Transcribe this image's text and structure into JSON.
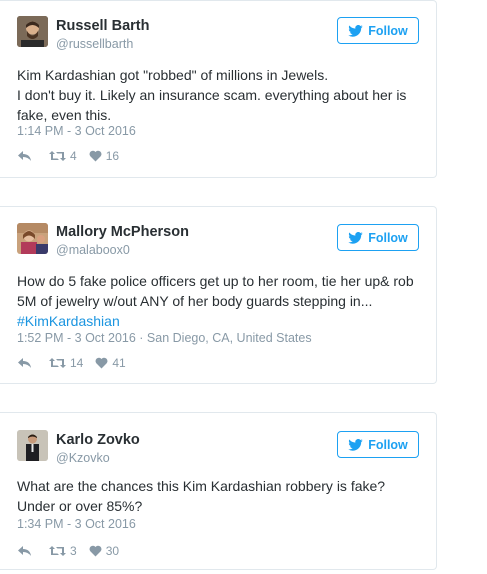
{
  "tweets": [
    {
      "name": "Russell Barth",
      "handle": "@russellbarth",
      "follow_label": "Follow",
      "lines": [
        "Kim Kardashian got \"robbed\" of millions in Jewels.",
        "I don't buy it. Likely an insurance scam. everything about her is",
        "fake, even this."
      ],
      "hashtag": "",
      "meta": "1:14 PM - 3 Oct 2016",
      "retweets": "4",
      "likes": "16",
      "avatar_icon": "person-photo"
    },
    {
      "name": "Mallory McPherson",
      "handle": "@malaboox0",
      "follow_label": "Follow",
      "lines": [
        "How do 5 fake police officers get up to her room, tie her up& rob",
        "5M of jewelry w/out ANY of her body guards stepping in..."
      ],
      "hashtag": "#KimKardashian",
      "meta": "1:52 PM - 3 Oct 2016 · San Diego, CA, United States",
      "retweets": "14",
      "likes": "41",
      "avatar_icon": "person-photo"
    },
    {
      "name": "Karlo Zovko",
      "handle": "@Kzovko",
      "follow_label": "Follow",
      "lines": [
        "What are the chances this Kim Kardashian robbery is fake?",
        "Under or over 85%?"
      ],
      "hashtag": "",
      "meta": "1:34 PM - 3 Oct 2016",
      "retweets": "3",
      "likes": "30",
      "avatar_icon": "person-photo"
    }
  ],
  "colors": {
    "twitter_blue": "#1da1f2",
    "hashtag_blue": "#1b95e0",
    "muted_gray": "#8899a6",
    "text_dark": "#292f33",
    "border": "#e1e8ed"
  }
}
